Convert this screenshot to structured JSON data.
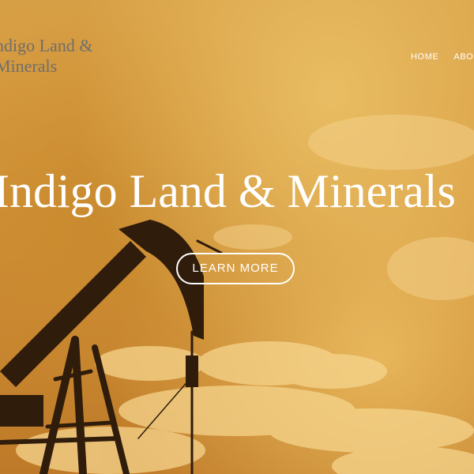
{
  "site": {
    "brand": "ndigo Land & Minerals",
    "hero_image": "oil pumpjack silhouette at sunset"
  },
  "nav": {
    "items": [
      {
        "label": "HOME"
      },
      {
        "label": "ABOU"
      }
    ]
  },
  "hero": {
    "title": "Indigo Land & Minerals",
    "cta_label": "LEARN MORE"
  },
  "colors": {
    "sky": "#d79f45",
    "silhouette": "#2f1c0b",
    "brand_text": "#6e6e6e",
    "hero_text": "#ffffff"
  }
}
